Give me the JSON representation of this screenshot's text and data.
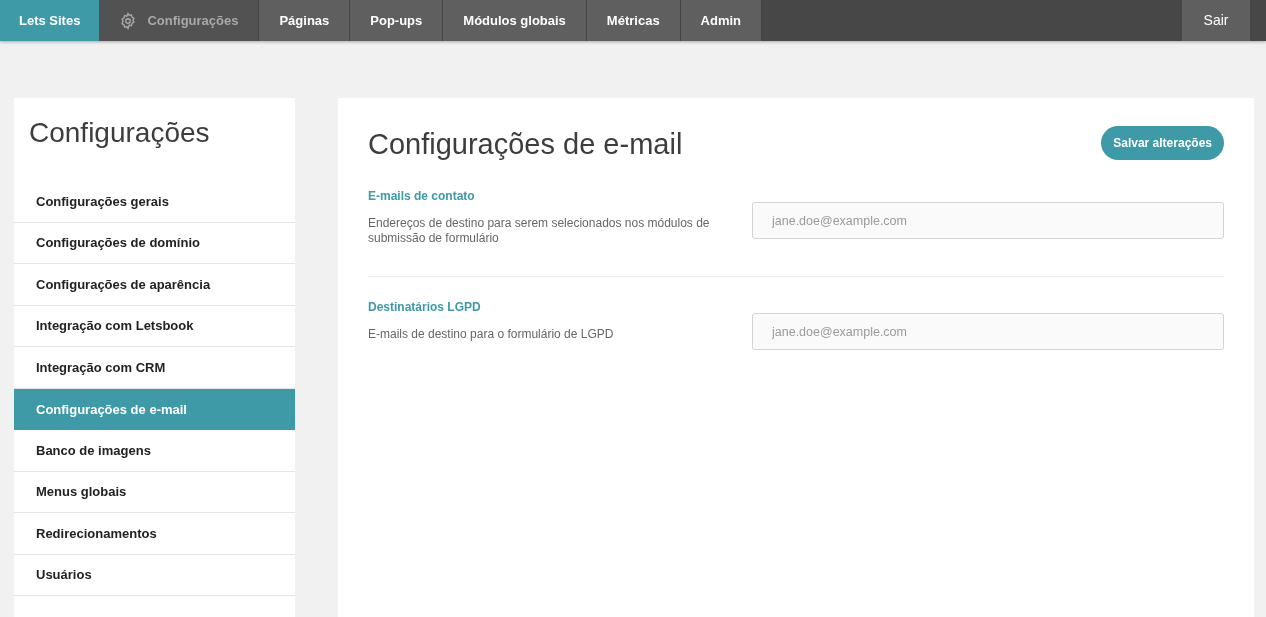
{
  "topbar": {
    "brand": "Lets Sites",
    "items": [
      {
        "label": "Configurações",
        "selected": true,
        "kind": "iconic"
      },
      {
        "label": "Páginas",
        "selected": false
      },
      {
        "label": "Pop-ups",
        "selected": false
      },
      {
        "label": "Módulos globais",
        "selected": false
      },
      {
        "label": "Métricas",
        "selected": false
      },
      {
        "label": "Admin",
        "selected": false
      }
    ],
    "logout": "Sair"
  },
  "sidebar": {
    "title": "Configurações",
    "items": [
      {
        "label": "Configurações gerais",
        "selected": false
      },
      {
        "label": "Configurações de domínio",
        "selected": false
      },
      {
        "label": "Configurações de aparência",
        "selected": false
      },
      {
        "label": "Integração com Letsbook",
        "selected": false
      },
      {
        "label": "Integração com CRM",
        "selected": false
      },
      {
        "label": "Configurações de e-mail",
        "selected": true
      },
      {
        "label": "Banco de imagens",
        "selected": false
      },
      {
        "label": "Menus globais",
        "selected": false
      },
      {
        "label": "Redirecionamentos",
        "selected": false
      },
      {
        "label": "Usuários",
        "selected": false
      }
    ]
  },
  "main": {
    "title": "Configurações de e-mail",
    "save_button": "Salvar alterações",
    "sections": [
      {
        "heading": "E-mails de contato",
        "description": "Endereços de destino para serem selecionados nos módulos de submissão de formulário",
        "placeholder": "jane.doe@example.com"
      },
      {
        "heading": "Destinatários LGPD",
        "description": "E-mails de destino para o formulário de LGPD",
        "placeholder": "jane.doe@example.com"
      }
    ]
  }
}
